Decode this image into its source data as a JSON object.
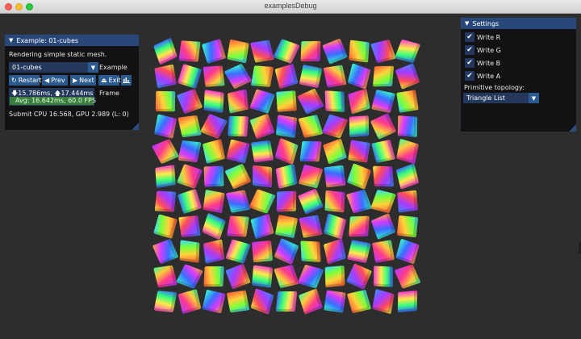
{
  "window": {
    "title": "examplesDebug"
  },
  "example_panel": {
    "title": "Example: 01-cubes",
    "description": "Rendering simple static mesh.",
    "example_select": {
      "value": "01-cubes",
      "label": "Example"
    },
    "buttons": {
      "restart": "Restart",
      "prev": "Prev",
      "next": "Next",
      "exit": "Exit"
    },
    "stats": {
      "cpu_time": "15.786ms",
      "gpu_time": "17.444ms",
      "avg": "Avg: 16.642ms, 60.0 FPS",
      "frame_label": "Frame"
    },
    "submit": "Submit CPU 16.568, GPU 2.989 (L: 0)"
  },
  "settings_panel": {
    "title": "Settings",
    "checkboxes": [
      {
        "label": "Write R",
        "checked": true
      },
      {
        "label": "Write G",
        "checked": true
      },
      {
        "label": "Write B",
        "checked": true
      },
      {
        "label": "Write A",
        "checked": true
      }
    ],
    "topology_label": "Primitive topology:",
    "topology_value": "Triangle List"
  },
  "colors": {
    "header": "#29487a",
    "button": "#2b5a8e",
    "frame_bg": "#23385a",
    "fps_bar": "#3b7d3d"
  },
  "icons": {
    "restart": "restart-icon",
    "prev": "arrow-left-icon",
    "next": "arrow-right-icon",
    "exit": "exit-icon",
    "stats": "bar-chart-icon"
  }
}
